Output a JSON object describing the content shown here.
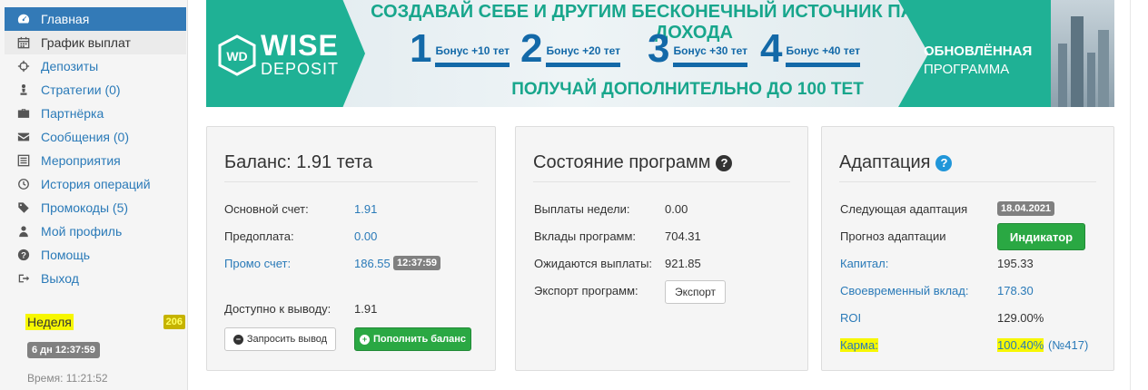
{
  "sidebar": {
    "items": [
      {
        "label": "Главная",
        "icon": "dashboard-icon"
      },
      {
        "label": "График выплат",
        "icon": "calendar-icon"
      },
      {
        "label": "Депозиты",
        "icon": "crosshair-icon"
      },
      {
        "label": "Стратегии (0)",
        "icon": "chess-pawn-icon"
      },
      {
        "label": "Партнёрка",
        "icon": "briefcase-icon"
      },
      {
        "label": "Сообщения (0)",
        "icon": "envelope-icon"
      },
      {
        "label": "Мероприятия",
        "icon": "list-icon"
      },
      {
        "label": "История операций",
        "icon": "history-icon"
      },
      {
        "label": "Промокоды (5)",
        "icon": "tag-icon"
      },
      {
        "label": "Мой профиль",
        "icon": "user-icon"
      },
      {
        "label": "Помощь",
        "icon": "question-icon"
      },
      {
        "label": "Выход",
        "icon": "logout-icon"
      }
    ],
    "week_label": "Неделя",
    "week_count": "206",
    "week_timer": "6 дн 12:37:59",
    "time_text": "Время: 11:21:52"
  },
  "banner": {
    "logo_main": "WISE",
    "logo_sub": "DEPOSIT",
    "headline": "СОЗДАВАЙ СЕБЕ И ДРУГИМ БЕСКОНЕЧНЫЙ ИСТОЧНИК ПАССИВНОГО ДОХОДА",
    "steps": [
      {
        "num": "1",
        "text": "Бонус +10 тет"
      },
      {
        "num": "2",
        "text": "Бонус +20 тет"
      },
      {
        "num": "3",
        "text": "Бонус +30 тет"
      },
      {
        "num": "4",
        "text": "Бонус +40 тет"
      }
    ],
    "subline": "ПОЛУЧАЙ ДОПОЛНИТЕЛЬНО ДО 100 ТЕТ",
    "program_line1": "ОБНОВЛЁННАЯ",
    "program_line2": "ПРОГРАММА"
  },
  "balance": {
    "title": "Баланс: 1.91 тета",
    "main_label": "Основной счет:",
    "main_value": "1.91",
    "prepay_label": "Предоплата:",
    "prepay_value": "0.00",
    "promo_label": "Промо счет:",
    "promo_value": "186.55",
    "promo_timer": "12:37:59",
    "available_label": "Доступно к выводу:",
    "available_value": "1.91",
    "withdraw_btn": "Запросить вывод",
    "topup_btn": "Пополнить баланс"
  },
  "programs": {
    "title": "Состояние программ",
    "week_pay_label": "Выплаты недели:",
    "week_pay_value": "0.00",
    "deposits_label": "Вклады программ:",
    "deposits_value": "704.31",
    "expected_label": "Ожидаются выплаты:",
    "expected_value": "921.85",
    "export_label": "Экспорт программ:",
    "export_btn": "Экспорт"
  },
  "adaptation": {
    "title": "Адаптация",
    "next_label": "Следующая адаптация",
    "next_date": "18.04.2021",
    "forecast_label": "Прогноз адаптации",
    "indicator_btn": "Индикатор",
    "capital_label": "Капитал:",
    "capital_value": "195.33",
    "timely_label": "Своевременный вклад:",
    "timely_value": "178.30",
    "roi_label": "ROI",
    "roi_value": "129.00%",
    "karma_label": "Карма:",
    "karma_value": "100.40%",
    "karma_rank": "(№417)"
  }
}
